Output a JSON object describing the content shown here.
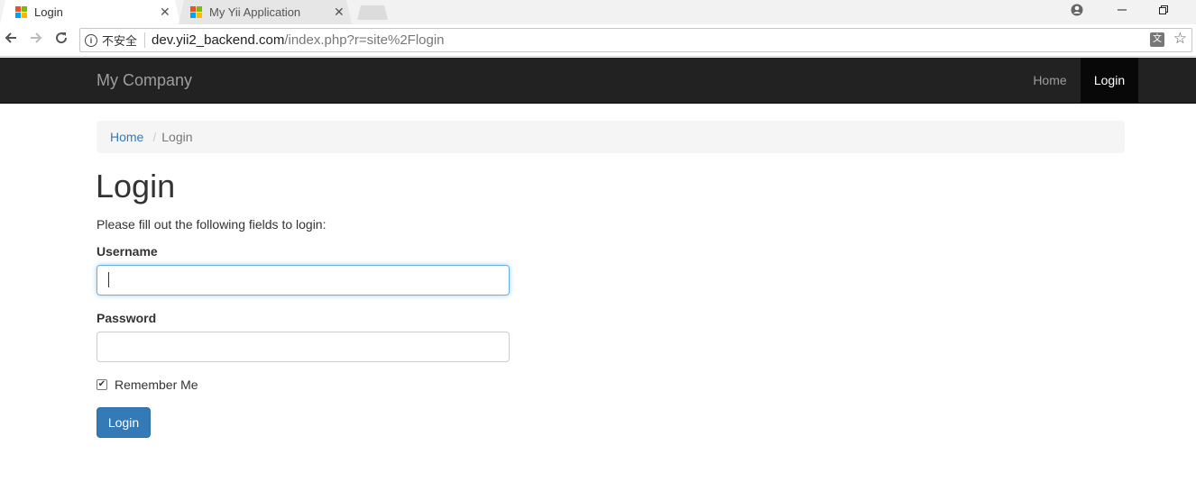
{
  "browser": {
    "tabs": [
      {
        "title": "Login",
        "active": true
      },
      {
        "title": "My Yii Application",
        "active": false
      }
    ],
    "close_glyph": "✕",
    "address": {
      "security_label": "不安全",
      "host": "dev.yii2_backend.com",
      "path": "/index.php?r=site%2Flogin"
    },
    "icons": [
      "back-icon",
      "forward-icon",
      "reload-icon",
      "info-icon",
      "translate-icon",
      "star-icon",
      "account-icon",
      "minimize-icon",
      "restore-icon"
    ],
    "favicon_colors": [
      "#f25022",
      "#7fba00",
      "#00a4ef",
      "#ffb900"
    ]
  },
  "navbar": {
    "brand": "My Company",
    "items": [
      {
        "label": "Home",
        "active": false
      },
      {
        "label": "Login",
        "active": true
      }
    ],
    "background": "#222222"
  },
  "breadcrumb": {
    "home": "Home",
    "separator": "/",
    "current": "Login"
  },
  "page": {
    "title": "Login",
    "intro": "Please fill out the following fields to login:"
  },
  "form": {
    "username_label": "Username",
    "username_value": "",
    "password_label": "Password",
    "password_value": "",
    "remember_label": "Remember Me",
    "remember_checked": true,
    "submit_label": "Login"
  },
  "colors": {
    "link": "#337ab7",
    "primary_button": "#337ab7",
    "focus_border": "#66afe9"
  }
}
